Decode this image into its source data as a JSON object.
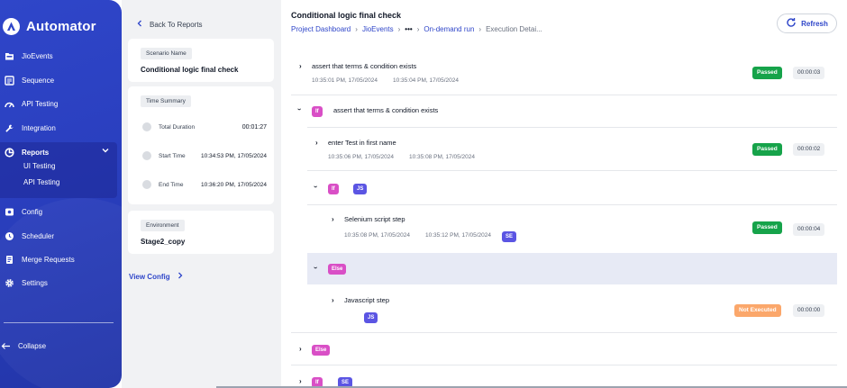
{
  "app": {
    "name": "Automator"
  },
  "sidebar": {
    "items": [
      {
        "label": "JioEvents",
        "icon": "folder-icon"
      },
      {
        "label": "Sequence",
        "icon": "sequence-icon"
      },
      {
        "label": "API Testing",
        "icon": "api-icon"
      },
      {
        "label": "Integration",
        "icon": "wrench-icon"
      },
      {
        "label": "Reports",
        "icon": "reports-icon"
      },
      {
        "label": "Config",
        "icon": "config-icon"
      },
      {
        "label": "Scheduler",
        "icon": "clock-icon"
      },
      {
        "label": "Merge Requests",
        "icon": "merge-icon"
      },
      {
        "label": "Settings",
        "icon": "gear-icon"
      }
    ],
    "reports_sub": [
      "UI Testing",
      "API Testing"
    ],
    "collapse_label": "Collapse"
  },
  "details": {
    "back_label": "Back To Reports",
    "scenario_tag": "Scenario Name",
    "scenario_value": "Conditional logic final check",
    "time_tag": "Time Summary",
    "total_label": "Total Duration",
    "total_value": "00:01:27",
    "start_label": "Start Time",
    "start_value": "10:34:53 PM, 17/05/2024",
    "end_label": "End Time",
    "end_value": "10:36:20 PM, 17/05/2024",
    "env_tag": "Environment",
    "env_value": "Stage2_copy",
    "view_config": "View Config"
  },
  "header": {
    "title": "Conditional logic final check",
    "crumbs": [
      "Project Dashboard",
      "JioEvents",
      "•••",
      "On-demand run",
      "Execution Detai..."
    ],
    "refresh": "Refresh"
  },
  "steps": {
    "s1": {
      "title": "assert that terms & condition exists",
      "start": "10:35:01 PM, 17/05/2024",
      "end": "10:35:04 PM, 17/05/2024",
      "status": "Passed",
      "duration": "00:00:03"
    },
    "s2": {
      "badge": "If",
      "title": "assert that terms & condition exists"
    },
    "s3": {
      "title": "enter Test in first name",
      "start": "10:35:06 PM, 17/05/2024",
      "end": "10:35:08 PM, 17/05/2024",
      "status": "Passed",
      "duration": "00:00:02"
    },
    "s4": {
      "badge_if": "If",
      "badge_js": "JS"
    },
    "s5": {
      "title": "Selenium script step",
      "start": "10:35:08 PM, 17/05/2024",
      "end": "10:35:12 PM, 17/05/2024",
      "badge": "SE",
      "status": "Passed",
      "duration": "00:00:04"
    },
    "s6": {
      "badge": "Else"
    },
    "s7": {
      "title": "Javascript step",
      "badge": "JS",
      "status": "Not Executed",
      "duration": "00:00:00"
    },
    "s8": {
      "badge": "Else"
    },
    "s9": {
      "badge_if": "If",
      "badge_se": "SE"
    }
  },
  "colors": {
    "sidebar": "#2f46c9",
    "accent": "#2f46c9",
    "passed": "#16a34a",
    "not_executed": "#fba76b",
    "if_badge": "#d94fc6",
    "js_badge": "#5b55e3"
  }
}
